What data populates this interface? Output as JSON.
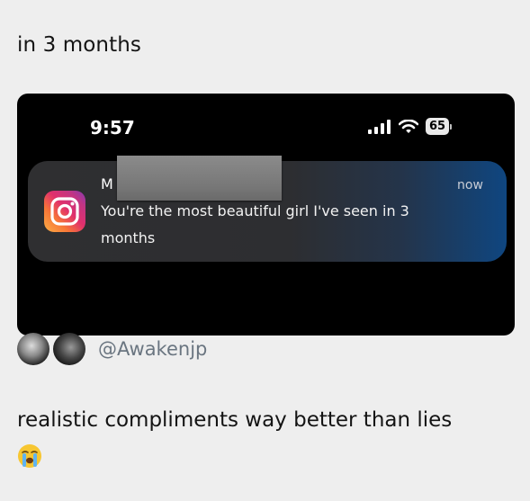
{
  "post": {
    "caption": "in 3 months",
    "footer_text": "realistic compliments way better than lies",
    "footer_emoji": "loudly-crying-face-emoji"
  },
  "phone_screenshot": {
    "status_bar": {
      "time": "9:57",
      "battery": "65",
      "icons": [
        "signal-bars-icon",
        "wifi-icon",
        "battery-icon"
      ]
    },
    "notification": {
      "app_icon": "instagram-icon",
      "sender_visible": "M",
      "sender_redacted": true,
      "message": "You're the most beautiful girl I've seen in 3 months",
      "timestamp": "now"
    }
  },
  "attribution": {
    "handle": "@Awakenjp"
  },
  "colors": {
    "page_bg": "#eeeeee",
    "phone_bg": "#000000",
    "notification_bg": "#2f2f31",
    "notification_accent": "#0f4680",
    "handle_text": "#6a7580"
  }
}
